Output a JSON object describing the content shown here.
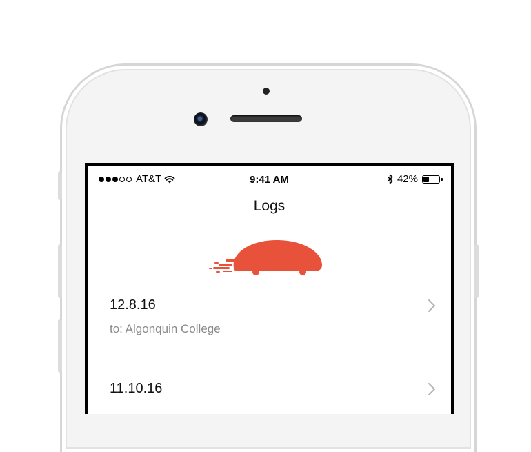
{
  "status_bar": {
    "signal_dots_filled": 3,
    "signal_dots_total": 5,
    "carrier": "AT&T",
    "time": "9:41 AM",
    "battery_percent": "42%",
    "battery_level": 0.42
  },
  "header": {
    "title": "Logs"
  },
  "logo": {
    "name": "car-icon",
    "color": "#E8513A"
  },
  "logs": [
    {
      "date": "12.8.16",
      "destination": "to: Algonquin College"
    },
    {
      "date": "11.10.16",
      "destination": ""
    }
  ],
  "colors": {
    "accent": "#E8513A",
    "secondary_text": "#8A8A8A",
    "divider": "#D8D8D8"
  }
}
